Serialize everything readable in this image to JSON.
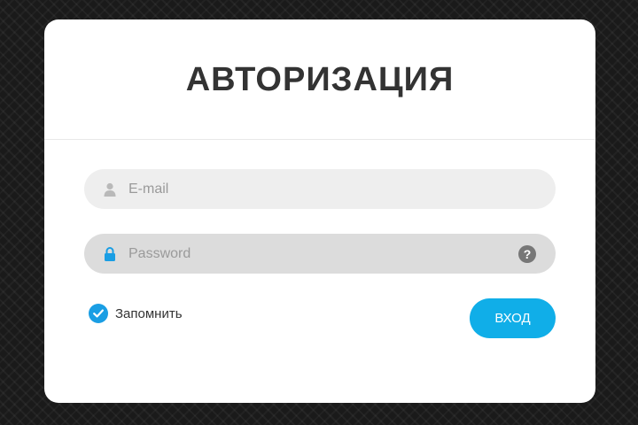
{
  "form": {
    "title": "АВТОРИЗАЦИЯ",
    "email": {
      "placeholder": "E-mail",
      "value": "",
      "icon": "user-icon"
    },
    "password": {
      "placeholder": "Password",
      "value": "",
      "icon": "lock-icon",
      "help_icon": "?"
    },
    "remember": {
      "label": "Запомнить",
      "checked": true
    },
    "submit_label": "ВХОД"
  },
  "colors": {
    "accent": "#10aee8",
    "checkbox": "#1a9ee4",
    "title": "#333333",
    "background": "#1a1a1a",
    "card": "#ffffff"
  }
}
